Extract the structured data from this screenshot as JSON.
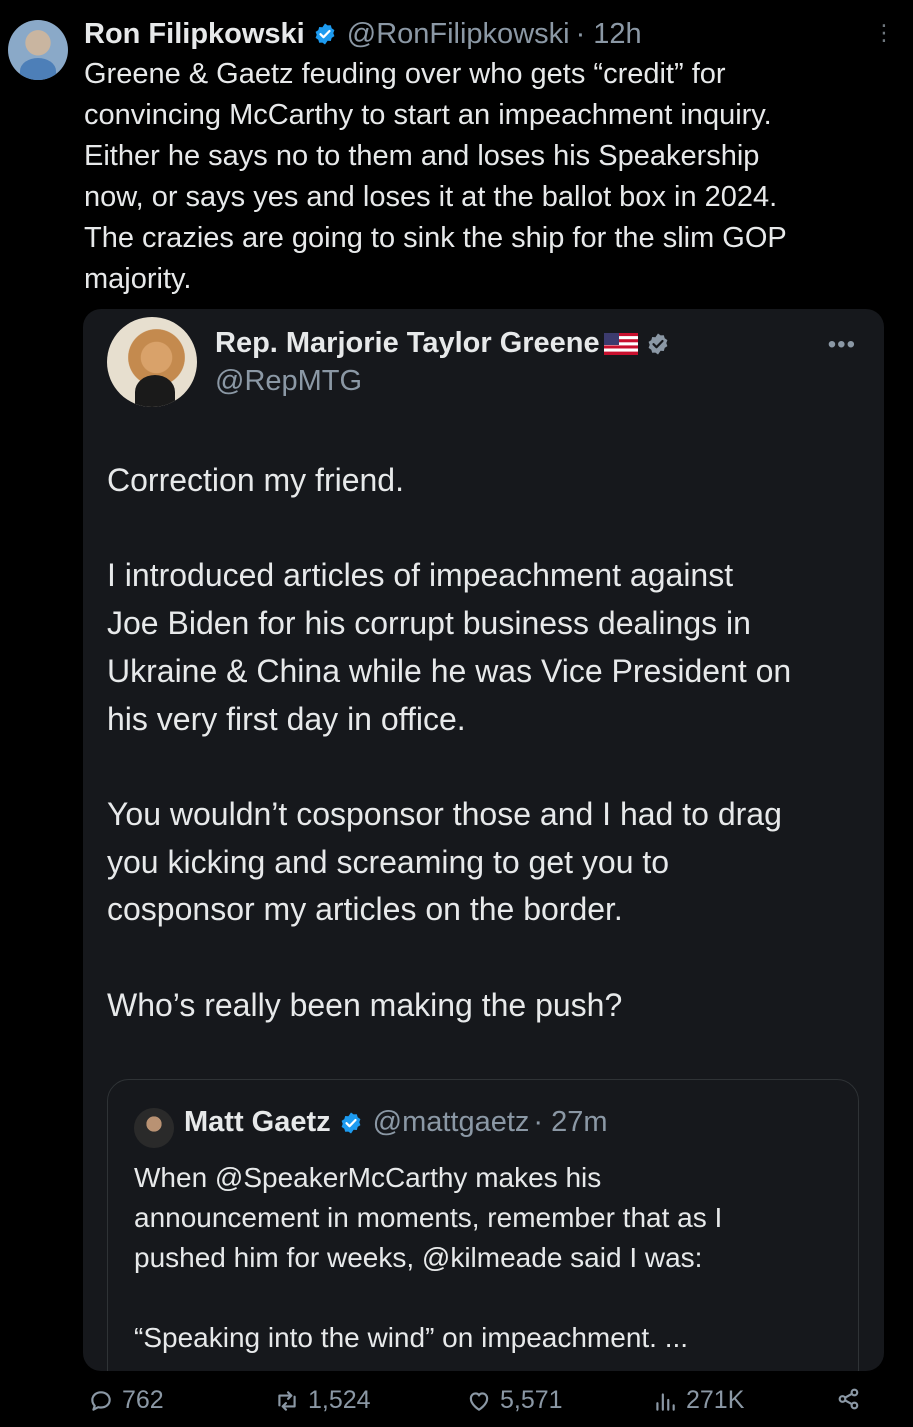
{
  "tweet": {
    "author_name": "Ron Filipkowski",
    "author_handle": "@RonFilipkowski",
    "time": "· 12h",
    "more": "⋮",
    "text": "Greene & Gaetz feuding over who gets “credit” for\nconvincing McCarthy to start an impeachment inquiry.\nEither he says no to them and loses his Speakership\nnow, or says yes and loses it at the ballot box in 2024.\nThe crazies are going to sink the ship for the slim GOP\nmajority."
  },
  "quoted": {
    "author_name": "Rep. Marjorie Taylor Greene",
    "author_handle": "@RepMTG",
    "more": "•••",
    "text": "Correction my friend.\n\nI introduced articles of impeachment against\nJoe Biden for his corrupt business dealings in\nUkraine & China while he was Vice President on\nhis very first day in office.\n\nYou wouldn’t cosponsor those and I had to drag\nyou kicking and screaming to get you to\ncosponsor my articles on the border.\n\nWho’s really been making the push?",
    "nested": {
      "author_name": "Matt Gaetz",
      "author_handle": "@mattgaetz",
      "time": "· 27m",
      "text": "When @SpeakerMcCarthy makes his\nannouncement in moments, remember that as I\npushed him for weeks, @kilmeade said I was:\n\n“Speaking into the wind” on impeachment. ..."
    }
  },
  "actions": {
    "replies": "762",
    "reposts": "1,524",
    "likes": "5,571",
    "views": "271K"
  },
  "colors": {
    "background": "#000000",
    "card": "#16181c",
    "text": "#e7e9ea",
    "muted": "#8b98a5",
    "verified": "#1d9bf0"
  },
  "icons": [
    "verified-badge-icon",
    "us-flag-icon",
    "reply-icon",
    "repost-icon",
    "like-icon",
    "views-icon",
    "share-icon",
    "more-icon"
  ]
}
